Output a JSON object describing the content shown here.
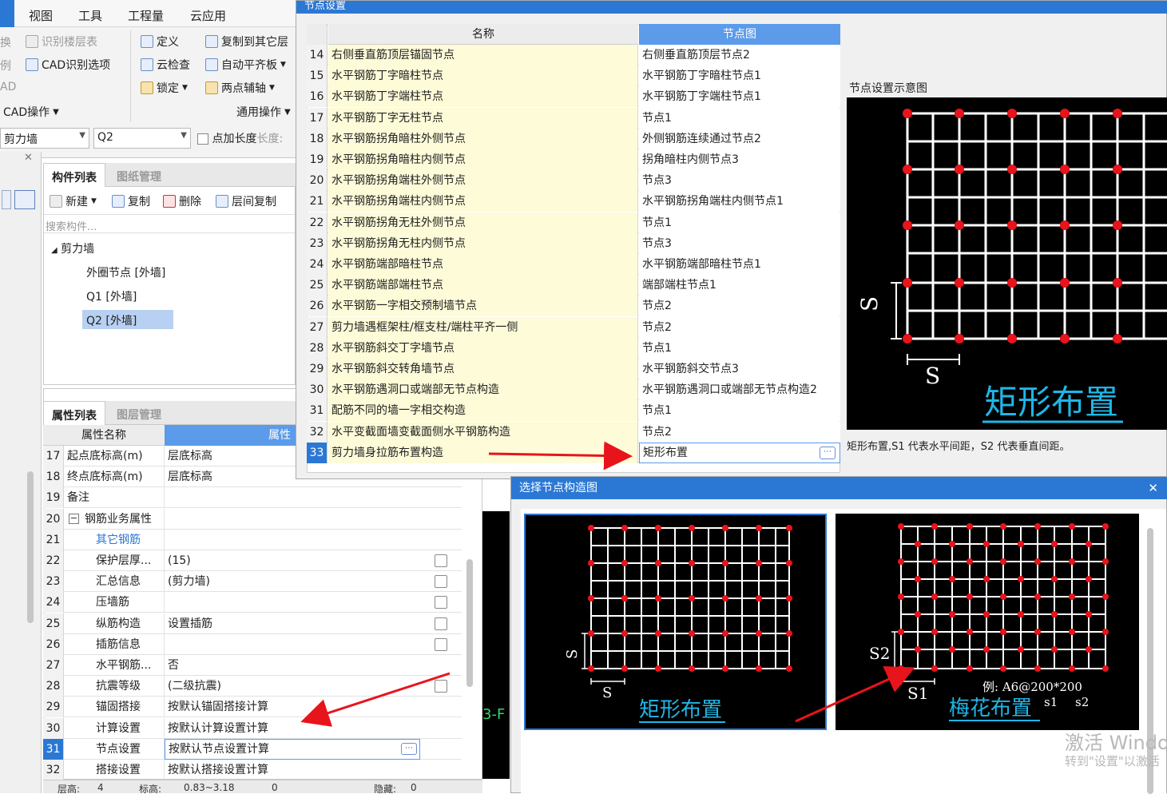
{
  "ribbon": {
    "tabs": [
      "视图",
      "工具",
      "工程量",
      "云应用"
    ],
    "left_edge_items": [
      "换",
      "例",
      "AD"
    ],
    "group1": {
      "identify_floor_table": "识别楼层表",
      "cad_options": "CAD识别选项",
      "group_label": "CAD操作"
    },
    "group2": {
      "define": "定义",
      "cloud_check": "云检查",
      "lock": "锁定",
      "copy_to_other": "复制到其它层",
      "auto_slab": "自动平齐板",
      "two_point_axis": "两点辅轴",
      "group_label": "通用操作"
    }
  },
  "selectors": {
    "type": "剪力墙",
    "component": "Q2",
    "point_length_label": "点加长度",
    "length_label": "长度:"
  },
  "component_panel": {
    "tabs": [
      "构件列表",
      "图纸管理"
    ],
    "toolbar": [
      "新建",
      "复制",
      "删除",
      "层间复制"
    ],
    "search_placeholder": "搜索构件...",
    "tree_root": "剪力墙",
    "tree_items": [
      "外圈节点 [外墙]",
      "Q1 [外墙]",
      "Q2 [外墙]"
    ]
  },
  "property_panel": {
    "tabs": [
      "属性列表",
      "图层管理"
    ],
    "header_name": "属性名称",
    "header_value": "属性",
    "rows": [
      {
        "num": "17",
        "name": "起点底标高(m)",
        "value": "层底标高",
        "check": false
      },
      {
        "num": "18",
        "name": "终点底标高(m)",
        "value": "层底标高",
        "check": false
      },
      {
        "num": "19",
        "name": "备注",
        "value": "",
        "check": false
      },
      {
        "num": "20",
        "name": "钢筋业务属性",
        "value": "",
        "check": false
      },
      {
        "num": "21",
        "name": "其它钢筋",
        "value": "",
        "check": false
      },
      {
        "num": "22",
        "name": "保护层厚...",
        "value": "(15)",
        "check": true
      },
      {
        "num": "23",
        "name": "汇总信息",
        "value": "(剪力墙)",
        "check": true
      },
      {
        "num": "24",
        "name": "压墙筋",
        "value": "",
        "check": true
      },
      {
        "num": "25",
        "name": "纵筋构造",
        "value": "设置插筋",
        "check": true
      },
      {
        "num": "26",
        "name": "插筋信息",
        "value": "",
        "check": true
      },
      {
        "num": "27",
        "name": "水平钢筋...",
        "value": "否",
        "check": false
      },
      {
        "num": "28",
        "name": "抗震等级",
        "value": "(二级抗震)",
        "check": true
      },
      {
        "num": "29",
        "name": "锚固搭接",
        "value": "按默认锚固搭接计算",
        "check": false
      },
      {
        "num": "30",
        "name": "计算设置",
        "value": "按默认计算设置计算",
        "check": false
      },
      {
        "num": "31",
        "name": "节点设置",
        "value": "按默认节点设置计算",
        "check": false
      },
      {
        "num": "32",
        "name": "搭接设置",
        "value": "按默认搭接设置计算",
        "check": false
      }
    ],
    "status": [
      "层高:",
      "4",
      "标高:",
      "0.83~3.18",
      "0",
      "隐藏:",
      "0"
    ]
  },
  "node_dialog": {
    "title": "节点设置",
    "header_name": "名称",
    "header_value": "节点图",
    "rows": [
      {
        "num": "14",
        "name": "右侧垂直筋顶层锚固节点",
        "value": "右侧垂直筋顶层节点2"
      },
      {
        "num": "15",
        "name": "水平钢筋丁字暗柱节点",
        "value": "水平钢筋丁字暗柱节点1"
      },
      {
        "num": "16",
        "name": "水平钢筋丁字端柱节点",
        "value": "水平钢筋丁字端柱节点1"
      },
      {
        "num": "17",
        "name": "水平钢筋丁字无柱节点",
        "value": "节点1"
      },
      {
        "num": "18",
        "name": "水平钢筋拐角暗柱外侧节点",
        "value": "外侧钢筋连续通过节点2"
      },
      {
        "num": "19",
        "name": "水平钢筋拐角暗柱内侧节点",
        "value": "拐角暗柱内侧节点3"
      },
      {
        "num": "20",
        "name": "水平钢筋拐角端柱外侧节点",
        "value": "节点3"
      },
      {
        "num": "21",
        "name": "水平钢筋拐角端柱内侧节点",
        "value": "水平钢筋拐角端柱内侧节点1"
      },
      {
        "num": "22",
        "name": "水平钢筋拐角无柱外侧节点",
        "value": "节点1"
      },
      {
        "num": "23",
        "name": "水平钢筋拐角无柱内侧节点",
        "value": "节点3"
      },
      {
        "num": "24",
        "name": "水平钢筋端部暗柱节点",
        "value": "水平钢筋端部暗柱节点1"
      },
      {
        "num": "25",
        "name": "水平钢筋端部端柱节点",
        "value": "端部端柱节点1"
      },
      {
        "num": "26",
        "name": "水平钢筋一字相交预制墙节点",
        "value": "节点2"
      },
      {
        "num": "27",
        "name": "剪力墙遇框架柱/框支柱/端柱平齐一侧",
        "value": "节点2"
      },
      {
        "num": "28",
        "name": "水平钢筋斜交丁字墙节点",
        "value": "节点1"
      },
      {
        "num": "29",
        "name": "水平钢筋斜交转角墙节点",
        "value": "水平钢筋斜交节点3"
      },
      {
        "num": "30",
        "name": "水平钢筋遇洞口或端部无节点构造",
        "value": "水平钢筋遇洞口或端部无节点构造2"
      },
      {
        "num": "31",
        "name": "配筋不同的墙一字相交构造",
        "value": "节点1"
      },
      {
        "num": "32",
        "name": "水平变截面墙变截面侧水平钢筋构造",
        "value": "节点2"
      },
      {
        "num": "33",
        "name": "剪力墙身拉筋布置构造",
        "value": "矩形布置"
      }
    ],
    "preview_title": "节点设置示意图",
    "preview_caption": "矩形布置",
    "preview_note": "矩形布置,S1 代表水平间距，S2 代表垂直间距。",
    "dim_s": "S"
  },
  "choose_dialog": {
    "title": "选择节点构造图",
    "options": [
      {
        "caption": "矩形布置",
        "dim_h": "S",
        "dim_v": "S"
      },
      {
        "caption": "梅花布置",
        "dim_h": "S1",
        "dim_v": "S2",
        "example": "例:  A6@200*200",
        "ex_s1": "s1",
        "ex_s2": "s2"
      }
    ]
  },
  "watermark": {
    "line1": "激活 Windo",
    "line2": "转到\"设置\"以激活"
  },
  "canvas_label": "3-F",
  "colors": {
    "accent": "#2b78d4",
    "red": "#e8141b",
    "yellow_cell": "#fdfbd8",
    "preview_caption": "#1fb6e6"
  }
}
